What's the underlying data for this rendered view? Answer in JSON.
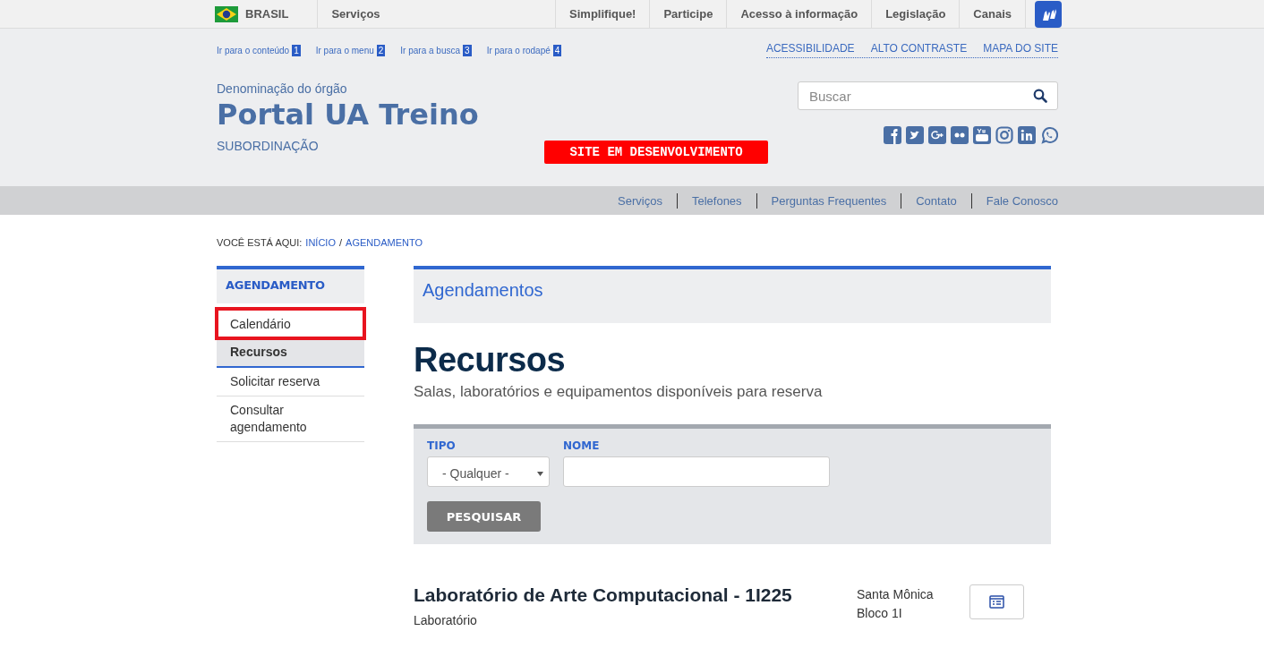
{
  "top_bar": {
    "country": "BRASIL",
    "left_links": [
      "Serviços"
    ],
    "right_links": [
      "Simplifique!",
      "Participe",
      "Acesso à informação",
      "Legislação",
      "Canais"
    ]
  },
  "skip_links": [
    {
      "label": "Ir para o conteúdo",
      "key": "1"
    },
    {
      "label": "Ir para o menu",
      "key": "2"
    },
    {
      "label": "Ir para a busca",
      "key": "3"
    },
    {
      "label": "Ir para o rodapé",
      "key": "4"
    }
  ],
  "accessibility_links": [
    "ACESSIBILIDADE",
    "ALTO CONTRASTE",
    "MAPA DO SITE"
  ],
  "header": {
    "organ": "Denominação do órgão",
    "title": "Portal UA Treino",
    "subordination": "SUBORDINAÇÃO",
    "dev_banner": "SITE EM DESENVOLVIMENTO",
    "search": {
      "placeholder": "Buscar"
    },
    "social": [
      {
        "kind": "facebook"
      },
      {
        "kind": "twitter"
      },
      {
        "kind": "googleplus"
      },
      {
        "kind": "flickr"
      },
      {
        "kind": "youtube"
      },
      {
        "kind": "instagram"
      },
      {
        "kind": "linkedin"
      },
      {
        "kind": "whatsapp"
      }
    ]
  },
  "nav_links": [
    "Serviços",
    "Telefones",
    "Perguntas Frequentes",
    "Contato",
    "Fale Conosco"
  ],
  "breadcrumb": {
    "label": "VOCÊ ESTÁ AQUI:",
    "items": [
      "INÍCIO",
      "AGENDAMENTO"
    ],
    "separator": "/"
  },
  "sidebar": {
    "title": "AGENDAMENTO",
    "items": [
      {
        "label": "Calendário",
        "selected": false,
        "highlighted": true
      },
      {
        "label": "Recursos",
        "selected": true,
        "highlighted": false
      },
      {
        "label": "Solicitar reserva",
        "selected": false,
        "highlighted": false
      },
      {
        "label": "Consultar agendamento",
        "selected": false,
        "highlighted": false
      }
    ]
  },
  "main": {
    "section": "Agendamentos",
    "heading": "Recursos",
    "description": "Salas, laboratórios e equipamentos disponíveis para reserva",
    "filters": {
      "type_label": "TIPO",
      "type_value": "- Qualquer -",
      "name_label": "NOME",
      "button": "PESQUISAR"
    },
    "resources": [
      {
        "name": "Laboratório de Arte Computacional - 1I225",
        "type": "Laboratório",
        "location": [
          "Santa Mônica",
          "Bloco 1I"
        ]
      }
    ]
  }
}
